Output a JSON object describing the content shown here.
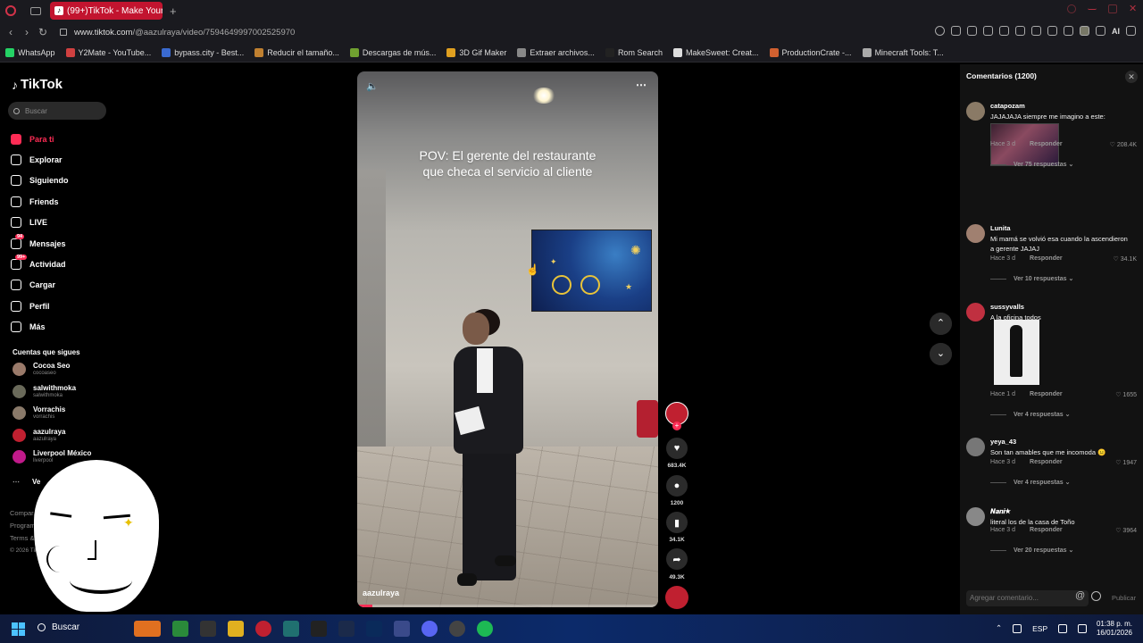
{
  "browser": {
    "tab_title": "(99+)TikTok - Make Your D",
    "url_prefix": "www.tiktok.com",
    "url_path": "/@aazulraya/video/7594649997002525970"
  },
  "bookmarks": [
    {
      "label": "WhatsApp",
      "color": "#25d366"
    },
    {
      "label": "Y2Mate - YouTube...",
      "color": "#d04040"
    },
    {
      "label": "bypass.city - Best...",
      "color": "#3a6ad0"
    },
    {
      "label": "Reducir el tamaño...",
      "color": "#c08030"
    },
    {
      "label": "Descargas de mús...",
      "color": "#70a030"
    },
    {
      "label": "3D Gif Maker",
      "color": "#e0a020"
    },
    {
      "label": "Extraer archivos...",
      "color": "#888888"
    },
    {
      "label": "Rom Search",
      "color": "#222222"
    },
    {
      "label": "MakeSweet: Creat...",
      "color": "#dddddd"
    },
    {
      "label": "ProductionCrate -...",
      "color": "#d06030"
    },
    {
      "label": "Minecraft Tools: T...",
      "color": "#aaaaaa"
    }
  ],
  "sidebar": {
    "logo": "TikTok",
    "search_placeholder": "Buscar",
    "nav": [
      {
        "label": "Para ti",
        "icon": "home-icon",
        "active": true
      },
      {
        "label": "Explorar",
        "icon": "compass-icon"
      },
      {
        "label": "Siguiendo",
        "icon": "following-icon"
      },
      {
        "label": "Friends",
        "icon": "friends-icon"
      },
      {
        "label": "LIVE",
        "icon": "live-icon"
      },
      {
        "label": "Mensajes",
        "icon": "messages-icon",
        "badge": "94"
      },
      {
        "label": "Actividad",
        "icon": "activity-icon",
        "badge": "99+"
      },
      {
        "label": "Cargar",
        "icon": "upload-icon"
      },
      {
        "label": "Perfil",
        "icon": "profile-icon"
      },
      {
        "label": "Más",
        "icon": "more-icon"
      }
    ],
    "following_heading": "Cuentas que sigues",
    "accounts": [
      {
        "name": "Cocoa Seo",
        "handle": "cocoaseo"
      },
      {
        "name": "salwithmoka",
        "handle": "salwithmoka"
      },
      {
        "name": "Vorrachis",
        "handle": "vorrachis"
      },
      {
        "name": "aazulraya",
        "handle": "aazulraya"
      },
      {
        "name": "Liverpool México",
        "handle": "liverpool"
      }
    ],
    "see_more": "Ve",
    "footer_lines": [
      "Compar",
      "Program",
      "Terms & F"
    ],
    "copyright": "© 2026 TikT"
  },
  "video": {
    "caption": "POV: El gerente del restaurante que checa el servicio al cliente",
    "author": "aazulraya",
    "progress": 0.05
  },
  "actions": {
    "likes": "683.4K",
    "comments": "1200",
    "saves": "34.1K",
    "shares": "49.3K"
  },
  "comments_panel": {
    "title": "Comentarios (1200)",
    "items": [
      {
        "user": "catapozam",
        "text": "JAJAJAJA siempre me imagino a este:",
        "time": "Hace 3 d",
        "reply": "Responder",
        "likes": "208.4K",
        "replies": "Ver 75 respuestas"
      },
      {
        "user": "Lunita",
        "text": "Mi mamá se volvió esa cuando la ascendieron a gerente JAJAJ",
        "time": "Hace 3 d",
        "reply": "Responder",
        "likes": "34.1K",
        "replies": "Ver 10 respuestas"
      },
      {
        "user": "sussyvalls",
        "text": "A la oficina todos",
        "time": "Hace 1 d",
        "reply": "Responder",
        "likes": "1655",
        "replies": "Ver 4 respuestas"
      },
      {
        "user": "yeya_43",
        "text": "Son tan amables que me incomoda 😐",
        "time": "Hace 3 d",
        "reply": "Responder",
        "likes": "1947",
        "replies": "Ver 4 respuestas"
      },
      {
        "user": "𝑵𝒂𝒏𝒊★",
        "text": "literal los de la casa de Toño",
        "time": "Hace 3 d",
        "reply": "Responder",
        "likes": "3964",
        "replies": "Ver 20 respuestas"
      }
    ],
    "add_placeholder": "Agregar comentario...",
    "publish": "Publicar"
  },
  "taskbar": {
    "search": "Buscar",
    "lang": "ESP",
    "time": "01:38 p. m.",
    "date": "16/01/2026"
  }
}
